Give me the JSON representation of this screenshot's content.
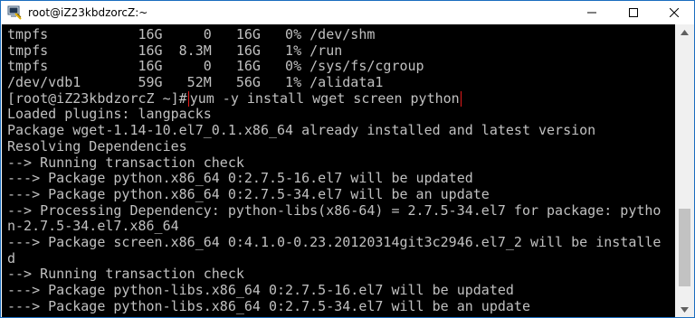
{
  "window": {
    "title": "root@iZ23kbdzorcZ:~",
    "icon": "putty-terminal-icon",
    "controls": [
      "minimize-icon",
      "maximize-icon",
      "close-icon"
    ]
  },
  "terminal": {
    "lines": [
      {
        "text": "tmpfs           16G     0   16G   0% /dev/shm"
      },
      {
        "text": "tmpfs           16G  8.3M   16G   1% /run"
      },
      {
        "text": "tmpfs           16G     0   16G   0% /sys/fs/cgroup"
      },
      {
        "text": "/dev/vdb1       59G   52M   56G   1% /alidata1"
      },
      {
        "prompt": "[root@iZ23kbdzorcZ ~]#",
        "command": "yum -y install wget screen python"
      },
      {
        "text": "Loaded plugins: langpacks"
      },
      {
        "text": "Package wget-1.14-10.el7_0.1.x86_64 already installed and latest version"
      },
      {
        "text": "Resolving Dependencies"
      },
      {
        "text": "--> Running transaction check"
      },
      {
        "text": "---> Package python.x86_64 0:2.7.5-16.el7 will be updated"
      },
      {
        "text": "---> Package python.x86_64 0:2.7.5-34.el7 will be an update"
      },
      {
        "text": "--> Processing Dependency: python-libs(x86-64) = 2.7.5-34.el7 for package: pytho"
      },
      {
        "text": "n-2.7.5-34.el7.x86_64"
      },
      {
        "text": "---> Package screen.x86_64 0:4.1.0-0.23.20120314git3c2946.el7_2 will be installe"
      },
      {
        "text": "d"
      },
      {
        "text": "--> Running transaction check"
      },
      {
        "text": "---> Package python-libs.x86_64 0:2.7.5-16.el7 will be updated"
      },
      {
        "text": "---> Package python-libs.x86_64 0:2.7.5-34.el7 will be an update"
      }
    ]
  },
  "colors": {
    "terminal_bg": "#000000",
    "terminal_fg": "#c0c0c0",
    "highlight_box": "#e21b1b",
    "window_border": "#1b6dbf"
  }
}
